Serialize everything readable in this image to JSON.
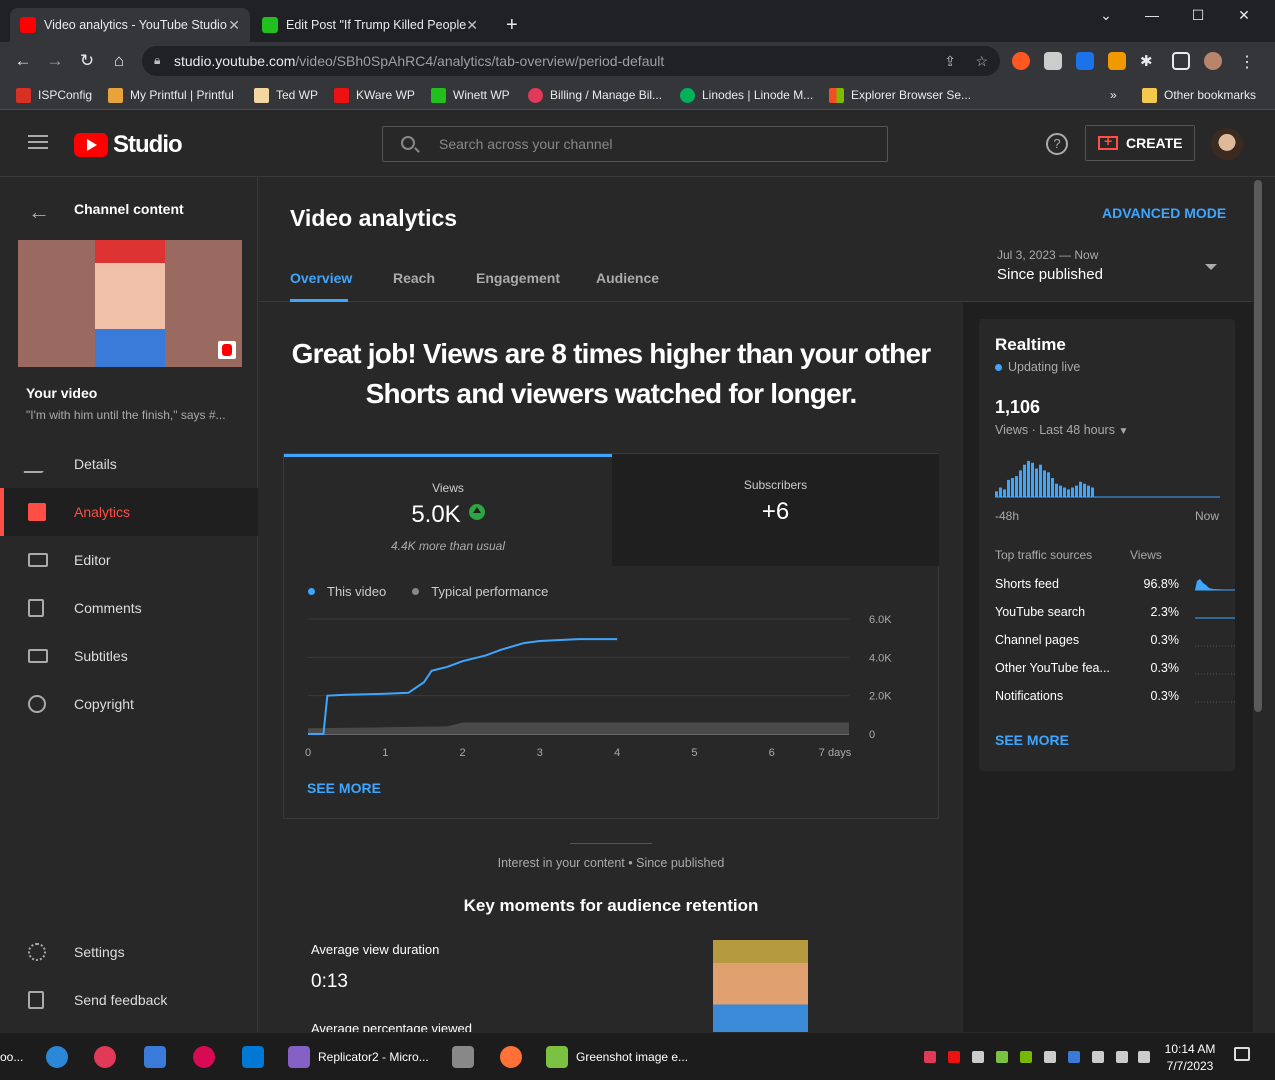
{
  "browser": {
    "tabs": [
      {
        "title": "Video analytics - YouTube Studio",
        "active": true
      },
      {
        "title": "Edit Post \"If Trump Killed People?\"",
        "active": false
      }
    ],
    "url_host": "studio.youtube.com",
    "url_path": "/video/SBh0SpAhRC4/analytics/tab-overview/period-default",
    "bookmarks": [
      "ISPConfig",
      "My Printful | Printful",
      "Ted WP",
      "KWare WP",
      "Winett WP",
      "Billing / Manage Bil...",
      "Linodes | Linode M...",
      "Explorer Browser Se..."
    ],
    "other_bookmarks": "Other bookmarks",
    "overflow": "»"
  },
  "header": {
    "logo_text": "Studio",
    "search_placeholder": "Search across your channel",
    "help": "?",
    "create_label": "CREATE"
  },
  "sidebar": {
    "back_title": "Channel content",
    "your_video": "Your video",
    "video_title": "\"I'm with him until the finish,\" says #...",
    "items": [
      {
        "label": "Details",
        "active": false
      },
      {
        "label": "Analytics",
        "active": true
      },
      {
        "label": "Editor",
        "active": false
      },
      {
        "label": "Comments",
        "active": false
      },
      {
        "label": "Subtitles",
        "active": false
      },
      {
        "label": "Copyright",
        "active": false
      }
    ],
    "bottom": [
      {
        "label": "Settings"
      },
      {
        "label": "Send feedback"
      }
    ]
  },
  "page": {
    "title": "Video analytics",
    "advanced_mode": "ADVANCED MODE",
    "tabs": [
      "Overview",
      "Reach",
      "Engagement",
      "Audience"
    ],
    "period_dates": "Jul 3, 2023 — Now",
    "period_value": "Since published",
    "headline": "Great job! Views are 8 times higher than your other Shorts and viewers watched for longer."
  },
  "metrics": {
    "views_label": "Views",
    "views_value": "5.0K",
    "views_sub": "4.4K more than usual",
    "subs_label": "Subscribers",
    "subs_value": "+6"
  },
  "chart": {
    "legend_this": "This video",
    "legend_typical": "Typical performance",
    "see_more": "SEE MORE",
    "colors": {
      "this": "#3ea6ff",
      "typical": "#4a4a4a"
    }
  },
  "chart_data": {
    "type": "line",
    "x_ticks": [
      "0",
      "1",
      "2",
      "3",
      "4",
      "5",
      "6",
      "7 days"
    ],
    "y_ticks": [
      "0",
      "2.0K",
      "4.0K",
      "6.0K"
    ],
    "ylim": [
      0,
      6000
    ],
    "xlim": [
      0,
      7
    ],
    "series": [
      {
        "name": "This video",
        "x": [
          0,
          0.2,
          0.25,
          0.5,
          1.0,
          1.3,
          1.5,
          1.6,
          1.8,
          2.0,
          2.3,
          2.5,
          2.8,
          3.0,
          3.5,
          4.0
        ],
        "y": [
          0,
          0,
          2000,
          2050,
          2100,
          2150,
          2700,
          3300,
          3500,
          3800,
          4100,
          4400,
          4750,
          4850,
          4950,
          4950
        ]
      },
      {
        "name": "Typical performance",
        "x": [
          0,
          1.0,
          1.8,
          2.0,
          3.0,
          7.0
        ],
        "y": [
          300,
          350,
          400,
          600,
          600,
          600
        ]
      }
    ]
  },
  "interest": {
    "caption": "Interest in your content • Since published",
    "heading": "Key moments for audience retention",
    "avd_label": "Average view duration",
    "avd_value": "0:13",
    "avp_label": "Average percentage viewed"
  },
  "realtime": {
    "title": "Realtime",
    "status": "Updating live",
    "count": "1,106",
    "count_label": "Views · Last 48 hours",
    "axis_left": "-48h",
    "axis_right": "Now",
    "bars": [
      3,
      5,
      4,
      9,
      10,
      11,
      14,
      17,
      19,
      18,
      15,
      17,
      14,
      13,
      10,
      7,
      6,
      5,
      4,
      5,
      6,
      8,
      7,
      6,
      5
    ],
    "traffic_header": "Top traffic sources",
    "traffic_views": "Views",
    "traffic": [
      {
        "label": "Shorts feed",
        "pct": "96.8%"
      },
      {
        "label": "YouTube search",
        "pct": "2.3%"
      },
      {
        "label": "Channel pages",
        "pct": "0.3%"
      },
      {
        "label": "Other YouTube fea...",
        "pct": "0.3%"
      },
      {
        "label": "Notifications",
        "pct": "0.3%"
      }
    ],
    "see_more": "SEE MORE"
  },
  "taskbar": {
    "left_clip": "oo...",
    "apps": [
      "Replicator2 - Micro...",
      "Greenshot image e..."
    ],
    "time": "10:14 AM",
    "date": "7/7/2023"
  }
}
